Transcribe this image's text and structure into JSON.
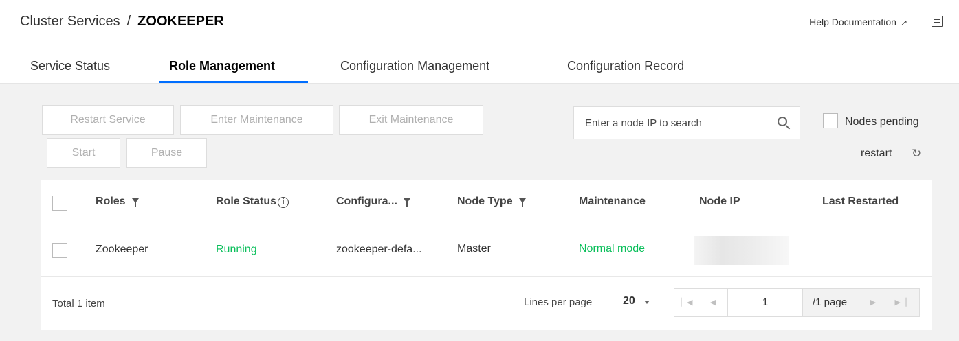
{
  "breadcrumb": {
    "parent": "Cluster Services",
    "separator": "/",
    "current": "ZOOKEEPER"
  },
  "header": {
    "help_label": "Help Documentation"
  },
  "tabs": [
    {
      "label": "Service Status"
    },
    {
      "label": "Role Management",
      "active": true
    },
    {
      "label": "Configuration Management"
    },
    {
      "label": "Configuration Record"
    }
  ],
  "toolbar": {
    "restart_service": "Restart Service",
    "enter_maintenance": "Enter Maintenance",
    "exit_maintenance": "Exit Maintenance",
    "start": "Start",
    "pause": "Pause",
    "search_placeholder": "Enter a node IP to search",
    "pending_label_1": "Nodes pending",
    "pending_label_2": "restart"
  },
  "table": {
    "columns": [
      "Roles",
      "Role Status",
      "Configura...",
      "Node Type",
      "Maintenance",
      "Node IP",
      "Last Restarted"
    ],
    "rows": [
      {
        "role": "Zookeeper",
        "status": "Running",
        "config": "zookeeper-defa...",
        "node_type": "Master",
        "maintenance": "Normal mode",
        "node_ip": "",
        "last_restarted": ""
      }
    ]
  },
  "pagination": {
    "total": "Total 1 item",
    "lines_label": "Lines per page",
    "lines_value": "20",
    "current_page": "1",
    "total_pages": "/1 page"
  },
  "colors": {
    "accent": "#006eff",
    "success": "#0abf5b",
    "background": "#f2f2f2"
  }
}
